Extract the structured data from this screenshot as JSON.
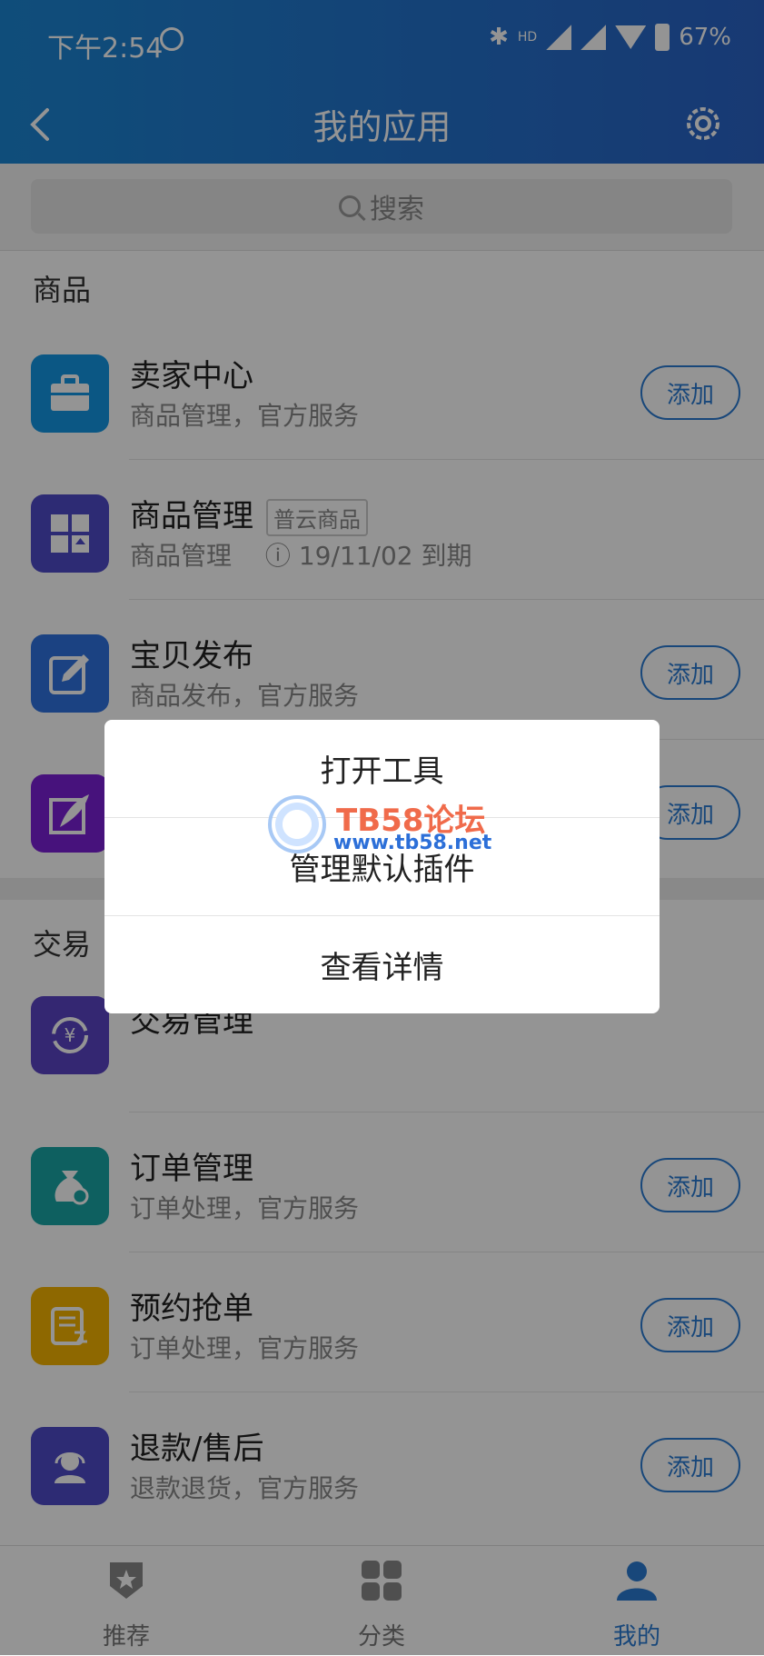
{
  "status": {
    "time": "下午2:54",
    "network": "HD",
    "battery": "67%"
  },
  "header": {
    "title": "我的应用"
  },
  "search": {
    "placeholder": "搜索"
  },
  "sections": [
    {
      "title": "商品",
      "items": [
        {
          "name": "卖家中心",
          "sub": "商品管理，官方服务",
          "button": "添加",
          "color": "#1497e4",
          "icon": "briefcase-icon"
        },
        {
          "name": "商品管理",
          "tag": "普云商品",
          "sub": "商品管理",
          "expiry": "19/11/02 到期",
          "color": "#4e4bc8",
          "icon": "grid-upload-icon"
        },
        {
          "name": "宝贝发布",
          "sub": "商品发布，官方服务",
          "button": "添加",
          "color": "#2f72e0",
          "icon": "edit-icon"
        },
        {
          "name": "",
          "sub": "",
          "button": "添加",
          "color": "#7b1fd6",
          "icon": "feather-icon"
        }
      ]
    },
    {
      "title": "交易",
      "items": [
        {
          "name": "交易管理",
          "sub": "",
          "color": "#5a44c4",
          "icon": "yuan-cycle-icon"
        },
        {
          "name": "订单管理",
          "sub": "订单处理，官方服务",
          "button": "添加",
          "color": "#19a6a6",
          "icon": "money-bag-icon"
        },
        {
          "name": "预约抢单",
          "sub": "订单处理，官方服务",
          "button": "添加",
          "color": "#f4b400",
          "icon": "schedule-icon"
        },
        {
          "name": "退款/售后",
          "sub": "退款退货，官方服务",
          "button": "添加",
          "color": "#4e4bc8",
          "icon": "customer-service-icon"
        }
      ]
    }
  ],
  "bottom_nav": [
    {
      "label": "推荐",
      "icon": "badge-star-icon"
    },
    {
      "label": "分类",
      "icon": "grid-icon"
    },
    {
      "label": "我的",
      "icon": "user-icon",
      "active": true
    }
  ],
  "dialog": {
    "options": [
      "打开工具",
      "管理默认插件",
      "查看详情"
    ]
  },
  "watermark": {
    "title": "TB58论坛",
    "url": "www.tb58.net"
  }
}
